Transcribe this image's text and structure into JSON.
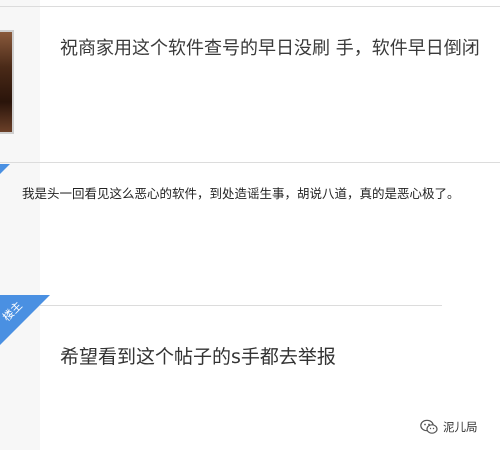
{
  "posts": [
    {
      "text": "祝商家用这个软件查号的早日没刷 手，软件早日倒闭"
    },
    {
      "text": "我是头一回看见这么恶心的软件，到处造谣生事，胡说八道，真的是恶心极了。"
    },
    {
      "text": "希望看到这个帖子的s手都去举报"
    }
  ],
  "owner_badge": {
    "label": "楼主"
  },
  "watermark": {
    "label": "泥儿局",
    "icon": "wechat-icon"
  },
  "colors": {
    "accent": "#4a90e2",
    "divider": "#dcdcdc",
    "panel": "#f7f7f7"
  }
}
